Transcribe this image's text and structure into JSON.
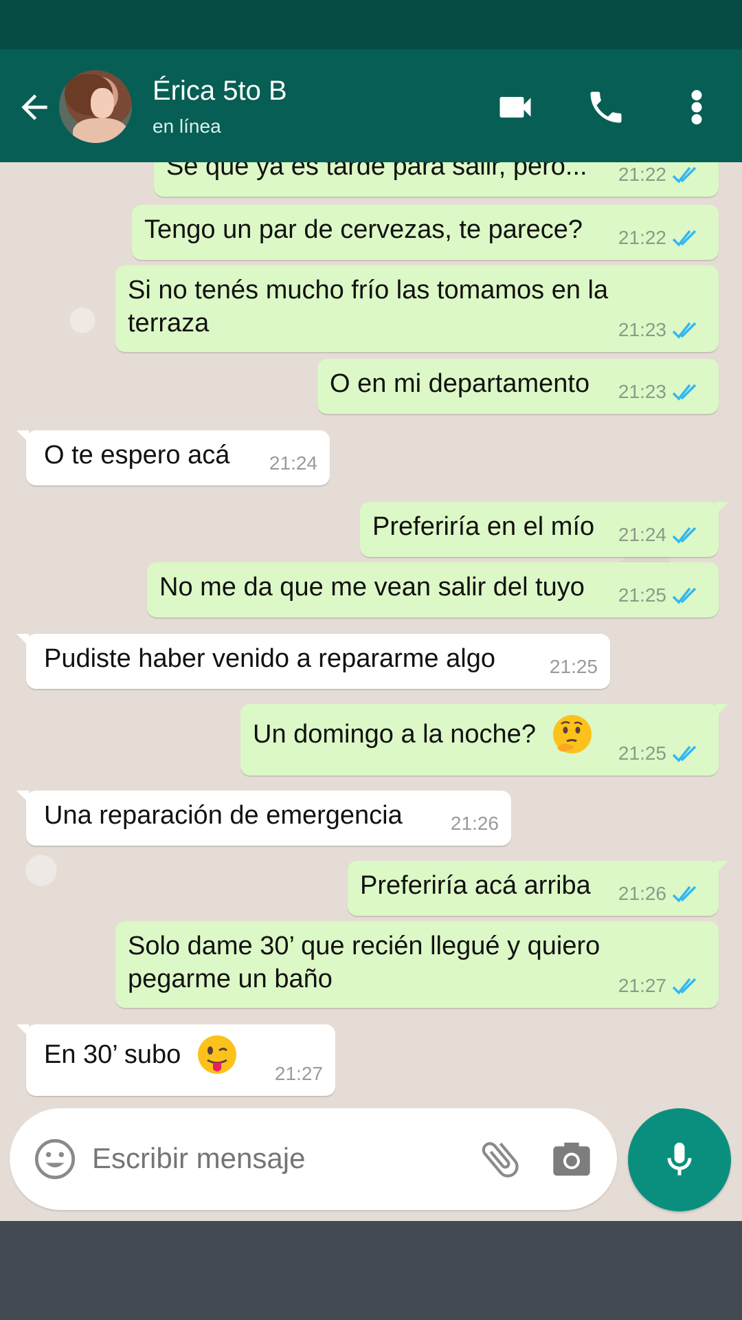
{
  "header": {
    "contact_name": "Érica 5to B",
    "contact_status": "en línea",
    "icons": [
      "back-arrow-icon",
      "video-call-icon",
      "phone-call-icon",
      "more-options-icon"
    ]
  },
  "messages": [
    {
      "dir": "out",
      "text": "Sé que ya es tarde para salir, pero...",
      "time": "21:22",
      "status": "read"
    },
    {
      "dir": "out",
      "text": "Tengo un par de cervezas, te parece?",
      "time": "21:22",
      "status": "read"
    },
    {
      "dir": "out",
      "text": "Si no tenés mucho frío las tomamos en la terraza",
      "time": "21:23",
      "status": "read"
    },
    {
      "dir": "out",
      "text": "O en mi departamento",
      "time": "21:23",
      "status": "read"
    },
    {
      "dir": "in",
      "text": "O te espero acá",
      "time": "21:24"
    },
    {
      "dir": "out",
      "text": "Preferiría en el mío",
      "time": "21:24",
      "status": "read"
    },
    {
      "dir": "out",
      "text": "No me da que me vean salir del tuyo",
      "time": "21:25",
      "status": "read"
    },
    {
      "dir": "in",
      "text": "Pudiste haber venido a repararme algo",
      "time": "21:25"
    },
    {
      "dir": "out",
      "text": "Un domingo a la noche?",
      "emoji": "thinking-face-emoji",
      "time": "21:25",
      "status": "read"
    },
    {
      "dir": "in",
      "text": "Una reparación de emergencia",
      "time": "21:26"
    },
    {
      "dir": "out",
      "text": "Preferiría acá arriba",
      "time": "21:26",
      "status": "read"
    },
    {
      "dir": "out",
      "text": "Solo dame 30’ que recién llegué y quiero pegarme un baño",
      "time": "21:27",
      "status": "read"
    },
    {
      "dir": "in",
      "text": "En 30’ subo",
      "emoji": "winking-face-with-tongue-emoji",
      "time": "21:27"
    }
  ],
  "composer": {
    "placeholder": "Escribir mensaje",
    "icons": [
      "emoji-icon",
      "attach-icon",
      "camera-icon",
      "mic-icon"
    ]
  },
  "colors": {
    "header_bg": "#075e54",
    "status_bar": "#054d44",
    "outgoing_bubble": "#dcf8c6",
    "incoming_bubble": "#ffffff",
    "read_ticks": "#34b7f1",
    "mic_button": "#0a8f7f"
  }
}
